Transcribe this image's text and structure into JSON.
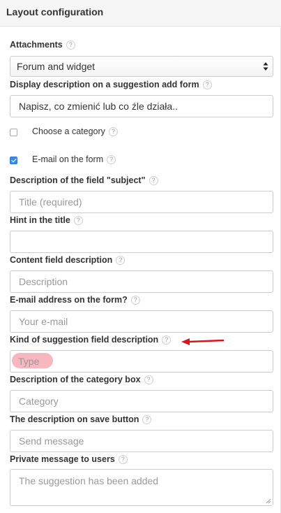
{
  "panel": {
    "title": "Layout configuration"
  },
  "attachments": {
    "label": "Attachments",
    "selected": "Forum and widget"
  },
  "display_description": {
    "label": "Display description on a suggestion add form",
    "value": "Napisz, co zmienić lub co źle działa.."
  },
  "choose_category": {
    "label": "Choose a category",
    "checked": false
  },
  "email_on_form": {
    "label": "E-mail on the form",
    "checked": true
  },
  "subject_description": {
    "label": "Description of the field \"subject\"",
    "placeholder": "Title (required)"
  },
  "hint_title": {
    "label": "Hint in the title",
    "value": ""
  },
  "content_description": {
    "label": "Content field description",
    "placeholder": "Description"
  },
  "email_address": {
    "label": "E-mail address on the form?",
    "placeholder": "Your e-mail"
  },
  "kind_description": {
    "label": "Kind of suggestion field description",
    "placeholder": "Type"
  },
  "category_box": {
    "label": "Description of the category box",
    "placeholder": "Category"
  },
  "save_button_description": {
    "label": "The description on save button",
    "placeholder": "Send message"
  },
  "private_message": {
    "label": "Private message to users",
    "placeholder": "The suggestion has been added"
  },
  "help_glyph": "?",
  "colors": {
    "annotation_arrow": "#d9141e",
    "annotation_highlight": "#f7a9b4",
    "checkbox_checked": "#3b89ea"
  },
  "icons": [
    "help-icon",
    "select-arrows-icon",
    "annotation-arrow-icon",
    "resize-grip-icon"
  ]
}
